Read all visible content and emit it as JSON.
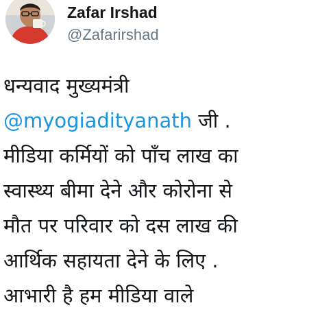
{
  "tweet": {
    "author": {
      "name": "Zafar Irshad",
      "handle": "@Zafarirshad"
    },
    "text": {
      "line1": "धन्यवाद मुख्यमंत्री",
      "mention": "@myogiadityanath",
      "line2_rest": " जी .",
      "line3": "मीडिया कर्मियों को पाँच लाख का",
      "line4": "स्वास्थ्य बीमा देने और कोरोना से",
      "line5": "मौत पर परिवार को दस लाख की",
      "line6": "आर्थिक सहायता देने के लिए .",
      "line7": "आभारी है हम मीडिया वाले"
    },
    "colors": {
      "mention": "#1b95e0",
      "handle": "#657786",
      "text": "#14171a"
    }
  }
}
